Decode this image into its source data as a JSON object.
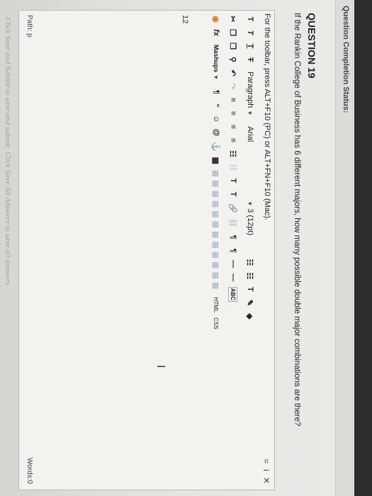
{
  "status_bar": {
    "label": "Question Completion Status:"
  },
  "question": {
    "title": "QUESTION 19",
    "text": "If the Rankin College of Business has 6 different majors, how many possible double major combinations are there?"
  },
  "editor": {
    "toolbar_hint": "For the toolbar, press ALT+F10 (PC) or ALT+FN+F10 (Mac).",
    "row1": {
      "bold": "T",
      "italic": "T",
      "underline": "T",
      "strike": "T",
      "paragraph": "Paragraph",
      "font": "Arial",
      "size": "3 (12pt)",
      "list_bullets": "☷",
      "list_numbers": "☷",
      "text_color": "T",
      "highlight": "✎",
      "eraser": "◆"
    },
    "row2": {
      "cut": "✂",
      "copy": "❐",
      "paste": "❐",
      "find": "⚲",
      "undo": "↶",
      "redo": "↷",
      "align": [
        "≡",
        "≡",
        "≡",
        "≡"
      ],
      "indent": [
        "☷",
        "☷"
      ],
      "superscript": "T",
      "subscript": "T",
      "link": "🔗",
      "unlink": "⛓",
      "ltr": "¶",
      "rtl": "¶",
      "hr": "—",
      "dash": "—",
      "spell": "ABC"
    },
    "row3": {
      "preview": "◉",
      "fx": "fx",
      "mashups": "Mashups",
      "pilcrow": "¶",
      "quote": "“",
      "emoji": "☺",
      "special": "@",
      "anchor": "⚓",
      "table": "▦",
      "html": "HTML",
      "css": "CSS"
    },
    "font_size_indicator": "12",
    "right_icons": [
      "⌗",
      "i",
      "✕"
    ],
    "path": "Path: p",
    "words": "Words:0"
  },
  "bottom_hint": "Click Save and Submit to save and submit. Click Save All Answers to save all answers."
}
